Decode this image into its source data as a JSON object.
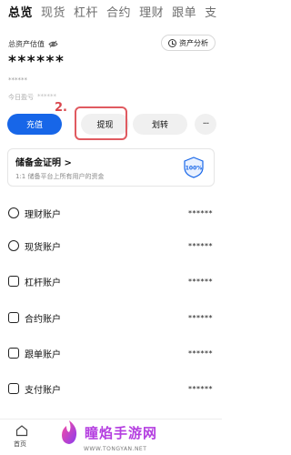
{
  "tabs": [
    "总览",
    "现货",
    "杠杆",
    "合约",
    "理财",
    "跟单",
    "支"
  ],
  "asset": {
    "label": "总资产估值",
    "analysis": "资产分析",
    "balance": "******",
    "balance_sub": "******",
    "pnl_label": "今日盈亏",
    "pnl_value": "******"
  },
  "actions": {
    "deposit": "充值",
    "withdraw": "提现",
    "transfer": "划转",
    "more": "···"
  },
  "annotation": {
    "step": "2."
  },
  "reserve": {
    "title": "储备金证明 >",
    "subtitle": "1:1 储备平台上所有用户的资金",
    "badge": "100%"
  },
  "accounts": [
    {
      "name": "理财账户",
      "value": "******",
      "icon": "wealth-icon"
    },
    {
      "name": "现货账户",
      "value": "******",
      "icon": "spot-icon"
    },
    {
      "name": "杠杆账户",
      "value": "******",
      "icon": "margin-icon"
    },
    {
      "name": "合约账户",
      "value": "******",
      "icon": "contract-icon"
    },
    {
      "name": "跟单账户",
      "value": "******",
      "icon": "copy-trade-icon"
    },
    {
      "name": "支付账户",
      "value": "******",
      "icon": "payment-icon"
    }
  ],
  "bottom_nav": {
    "home_label": "首页"
  },
  "watermark": {
    "text": "瞳焰手游网",
    "url": "WWW.TONGYAN.NET"
  },
  "colors": {
    "primary": "#1766e8",
    "highlight": "#e05a60",
    "watermark": "#b43ee0"
  }
}
